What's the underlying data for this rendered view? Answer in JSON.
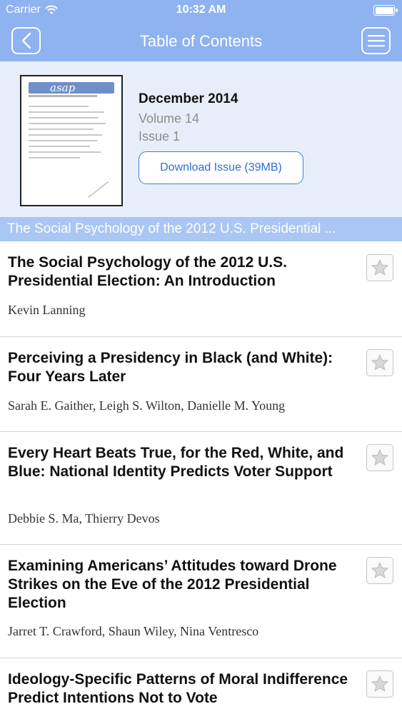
{
  "status_bar": {
    "carrier": "Carrier",
    "time": "10:32 AM"
  },
  "nav": {
    "title": "Table of Contents"
  },
  "issue": {
    "date": "December 2014",
    "volume": "Volume 14",
    "issue": "Issue 1",
    "download_label": "Download Issue (39MB)",
    "cover_logo": "asap"
  },
  "section": {
    "title": "The Social Psychology of the 2012 U.S. Presidential ..."
  },
  "articles": [
    {
      "title": "The Social Psychology of the 2012 U.S. Presidential Election: An Introduction",
      "authors": "Kevin Lanning"
    },
    {
      "title": "Perceiving a Presidency in Black (and White): Four Years Later",
      "authors": "Sarah E. Gaither, Leigh S. Wilton, Danielle M. Young"
    },
    {
      "title": "Every Heart Beats True, for the Red, White, and Blue: National Identity Predicts Voter Support",
      "authors": "Debbie S. Ma, Thierry Devos"
    },
    {
      "title": "Examining Americans’ Attitudes toward Drone Strikes on the Eve of the 2012 Presidential Election",
      "authors": "Jarret T. Crawford, Shaun Wiley, Nina Ventresco"
    },
    {
      "title": "Ideology-Specific Patterns of Moral Indifference Predict Intentions Not to Vote",
      "authors": ""
    }
  ],
  "icons": {
    "back": "chevron-left-icon",
    "menu": "hamburger-menu-icon",
    "star": "star-outline-icon",
    "wifi": "wifi-icon",
    "battery": "battery-icon"
  },
  "colors": {
    "nav_bar": "#8fb2f0",
    "header_bg": "#e7eef9",
    "section_bar": "#aac6f3",
    "link_blue": "#2f6fd2"
  }
}
